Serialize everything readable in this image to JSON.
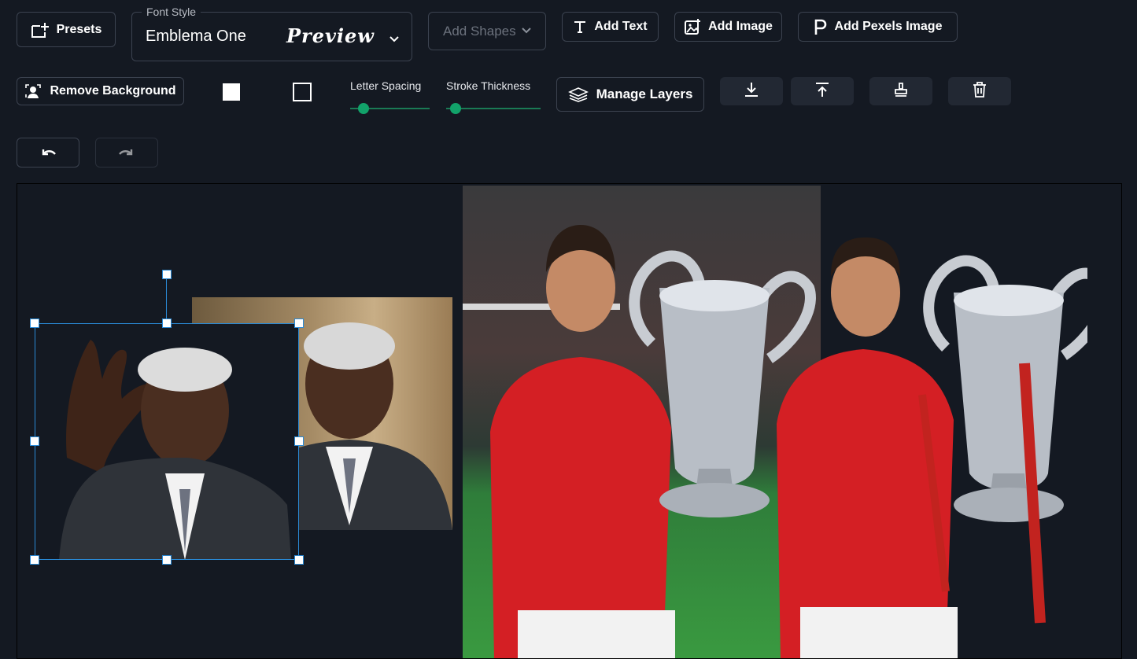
{
  "toolbar": {
    "presets_label": "Presets",
    "font_style": {
      "legend": "Font Style",
      "value": "Emblema One",
      "preview": "Preview"
    },
    "add_shapes_label": "Add Shapes",
    "add_text_label": "Add Text",
    "add_image_label": "Add Image",
    "add_pexels_label": "Add Pexels Image",
    "remove_bg_label": "Remove Background",
    "letter_spacing_label": "Letter Spacing",
    "stroke_thickness_label": "Stroke Thickness",
    "letter_spacing_value": 0.15,
    "stroke_thickness_value": 0.1,
    "manage_layers_label": "Manage Layers",
    "fill_color": "#ffffff",
    "stroke_color": "#ffffff"
  },
  "icons": {
    "presets": "add-frame-icon",
    "add_text": "text-t-icon",
    "add_image": "image-plus-icon",
    "add_pexels": "pexels-p-icon",
    "remove_bg": "person-remove-bg-icon",
    "manage_layers": "layers-icon",
    "download": "download-icon",
    "upload": "upload-icon",
    "stamp": "stamp-icon",
    "delete": "trash-icon",
    "undo": "undo-icon",
    "redo": "redo-icon"
  },
  "colors": {
    "background": "#141922",
    "accent": "#12a26a",
    "selection": "#2a8ad6"
  }
}
